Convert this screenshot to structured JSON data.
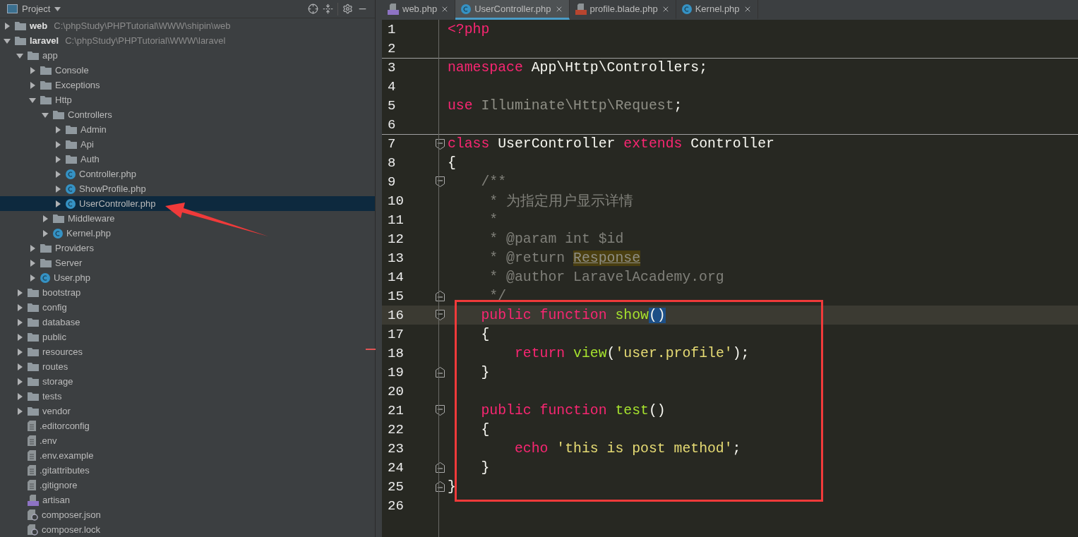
{
  "project_panel": {
    "title": "Project",
    "tree": [
      {
        "label": "web",
        "path": "C:\\phpStudy\\PHPTutorial\\WWW\\shipin\\web",
        "kind": "folder",
        "expanded": false,
        "selected": false
      },
      {
        "label": "laravel",
        "path": "C:\\phpStudy\\PHPTutorial\\WWW\\laravel",
        "kind": "folder",
        "expanded": true,
        "selected": false,
        "children": [
          {
            "label": "app",
            "kind": "folder",
            "expanded": true,
            "selected": false,
            "children": [
              {
                "label": "Console",
                "kind": "folder",
                "expanded": false,
                "selected": false
              },
              {
                "label": "Exceptions",
                "kind": "folder",
                "expanded": false,
                "selected": false
              },
              {
                "label": "Http",
                "kind": "folder",
                "expanded": true,
                "selected": false,
                "children": [
                  {
                    "label": "Controllers",
                    "kind": "folder",
                    "expanded": true,
                    "selected": false,
                    "children": [
                      {
                        "label": "Admin",
                        "kind": "folder",
                        "expanded": false,
                        "selected": false
                      },
                      {
                        "label": "Api",
                        "kind": "folder",
                        "expanded": false,
                        "selected": false
                      },
                      {
                        "label": "Auth",
                        "kind": "folder",
                        "expanded": false,
                        "selected": false
                      },
                      {
                        "label": "Controller.php",
                        "kind": "class",
                        "expanded": false,
                        "selected": false
                      },
                      {
                        "label": "ShowProfile.php",
                        "kind": "class",
                        "expanded": false,
                        "selected": false
                      },
                      {
                        "label": "UserController.php",
                        "kind": "class",
                        "expanded": false,
                        "selected": true
                      }
                    ]
                  },
                  {
                    "label": "Middleware",
                    "kind": "folder",
                    "expanded": false,
                    "selected": false
                  },
                  {
                    "label": "Kernel.php",
                    "kind": "class",
                    "expanded": false,
                    "selected": false
                  }
                ]
              },
              {
                "label": "Providers",
                "kind": "folder",
                "expanded": false,
                "selected": false
              },
              {
                "label": "Server",
                "kind": "folder",
                "expanded": false,
                "selected": false
              },
              {
                "label": "User.php",
                "kind": "class",
                "expanded": false,
                "selected": false
              }
            ]
          },
          {
            "label": "bootstrap",
            "kind": "folder",
            "expanded": false,
            "selected": false
          },
          {
            "label": "config",
            "kind": "folder",
            "expanded": false,
            "selected": false
          },
          {
            "label": "database",
            "kind": "folder",
            "expanded": false,
            "selected": false
          },
          {
            "label": "public",
            "kind": "folder",
            "expanded": false,
            "selected": false
          },
          {
            "label": "resources",
            "kind": "folder",
            "expanded": false,
            "selected": false
          },
          {
            "label": "routes",
            "kind": "folder",
            "expanded": false,
            "selected": false
          },
          {
            "label": "storage",
            "kind": "folder",
            "expanded": false,
            "selected": false
          },
          {
            "label": "tests",
            "kind": "folder",
            "expanded": false,
            "selected": false
          },
          {
            "label": "vendor",
            "kind": "folder",
            "expanded": false,
            "selected": false
          },
          {
            "label": ".editorconfig",
            "kind": "text",
            "selected": false
          },
          {
            "label": ".env",
            "kind": "text",
            "selected": false
          },
          {
            "label": ".env.example",
            "kind": "text",
            "selected": false
          },
          {
            "label": ".gitattributes",
            "kind": "text",
            "selected": false
          },
          {
            "label": ".gitignore",
            "kind": "text",
            "selected": false
          },
          {
            "label": "artisan",
            "kind": "php",
            "selected": false
          },
          {
            "label": "composer.json",
            "kind": "config",
            "selected": false
          },
          {
            "label": "composer.lock",
            "kind": "config",
            "selected": false
          }
        ]
      }
    ]
  },
  "editor": {
    "tabs": [
      {
        "label": "web.php",
        "kind": "php",
        "selected": false
      },
      {
        "label": "UserController.php",
        "kind": "class",
        "selected": true
      },
      {
        "label": "profile.blade.php",
        "kind": "blade",
        "selected": false
      },
      {
        "label": "Kernel.php",
        "kind": "class",
        "selected": false
      }
    ],
    "lines": [
      {
        "number": "1",
        "current": false,
        "separator_above": false,
        "tokens": [
          {
            "text": "<?php",
            "kind": "keyword"
          }
        ]
      },
      {
        "number": "2",
        "current": false,
        "separator_above": false
      },
      {
        "number": "3",
        "current": false,
        "separator_above": true,
        "tokens": [
          {
            "text": "namespace",
            "kind": "keyword"
          },
          {
            "text": " App\\Http\\Controllers;",
            "kind": "plain"
          }
        ]
      },
      {
        "number": "4",
        "current": false,
        "separator_above": false
      },
      {
        "number": "5",
        "current": false,
        "separator_above": false,
        "tokens": [
          {
            "text": "use",
            "kind": "keyword"
          },
          {
            "text": " Illuminate\\Http\\Request",
            "kind": "unused"
          },
          {
            "text": ";",
            "kind": "plain"
          }
        ]
      },
      {
        "number": "6",
        "current": false,
        "separator_above": false
      },
      {
        "number": "7",
        "current": false,
        "separator_above": true,
        "fold": {
          "kind": "open"
        },
        "tokens": [
          {
            "text": "class",
            "kind": "keyword"
          },
          {
            "text": " UserController ",
            "kind": "plain"
          },
          {
            "text": "extends",
            "kind": "keyword"
          },
          {
            "text": " Controller",
            "kind": "plain"
          }
        ]
      },
      {
        "number": "8",
        "current": false,
        "separator_above": false,
        "tokens": [
          {
            "text": "{",
            "kind": "plain"
          }
        ]
      },
      {
        "number": "9",
        "current": false,
        "separator_above": false,
        "fold": {
          "kind": "open"
        },
        "tokens": [
          {
            "text": "    /**",
            "kind": "comment"
          }
        ]
      },
      {
        "number": "10",
        "current": false,
        "separator_above": false,
        "tokens": [
          {
            "text": "     * 为指定用户显示详情",
            "kind": "comment"
          }
        ]
      },
      {
        "number": "11",
        "current": false,
        "separator_above": false,
        "tokens": [
          {
            "text": "     *",
            "kind": "comment"
          }
        ]
      },
      {
        "number": "12",
        "current": false,
        "separator_above": false,
        "tokens": [
          {
            "text": "     * @param int $id",
            "kind": "comment"
          }
        ]
      },
      {
        "number": "13",
        "current": false,
        "separator_above": false,
        "tokens": [
          {
            "text": "     * @return ",
            "kind": "comment"
          },
          {
            "text": "Response",
            "kind": "marked"
          }
        ]
      },
      {
        "number": "14",
        "current": false,
        "separator_above": false,
        "tokens": [
          {
            "text": "     * @author LaravelAcademy.org",
            "kind": "comment"
          }
        ]
      },
      {
        "number": "15",
        "current": false,
        "separator_above": false,
        "fold": {
          "kind": "close"
        },
        "tokens": [
          {
            "text": "     */",
            "kind": "comment"
          }
        ]
      },
      {
        "number": "16",
        "current": true,
        "separator_above": false,
        "fold": {
          "kind": "open"
        },
        "tokens": [
          {
            "text": "    public function",
            "kind": "keyword"
          },
          {
            "text": " show",
            "kind": "function"
          },
          {
            "text": "()",
            "kind": "matched"
          }
        ]
      },
      {
        "number": "17",
        "current": false,
        "separator_above": false,
        "tokens": [
          {
            "text": "    {",
            "kind": "plain"
          }
        ]
      },
      {
        "number": "18",
        "current": false,
        "separator_above": false,
        "tokens": [
          {
            "text": "        return",
            "kind": "keyword"
          },
          {
            "text": " view",
            "kind": "function"
          },
          {
            "text": "(",
            "kind": "plain"
          },
          {
            "text": "'user.profile'",
            "kind": "string"
          },
          {
            "text": ");",
            "kind": "plain"
          }
        ]
      },
      {
        "number": "19",
        "current": false,
        "separator_above": false,
        "fold": {
          "kind": "close"
        },
        "tokens": [
          {
            "text": "    }",
            "kind": "plain"
          }
        ]
      },
      {
        "number": "20",
        "current": false,
        "separator_above": false
      },
      {
        "number": "21",
        "current": false,
        "separator_above": false,
        "fold": {
          "kind": "open"
        },
        "tokens": [
          {
            "text": "    public function",
            "kind": "keyword"
          },
          {
            "text": " test",
            "kind": "function"
          },
          {
            "text": "()",
            "kind": "plain"
          }
        ]
      },
      {
        "number": "22",
        "current": false,
        "separator_above": false,
        "tokens": [
          {
            "text": "    {",
            "kind": "plain"
          }
        ]
      },
      {
        "number": "23",
        "current": false,
        "separator_above": false,
        "tokens": [
          {
            "text": "        echo",
            "kind": "keyword"
          },
          {
            "text": " 'this is post method'",
            "kind": "string"
          },
          {
            "text": ";",
            "kind": "plain"
          }
        ]
      },
      {
        "number": "24",
        "current": false,
        "separator_above": false,
        "fold": {
          "kind": "close"
        },
        "tokens": [
          {
            "text": "    }",
            "kind": "plain"
          }
        ]
      },
      {
        "number": "25",
        "current": false,
        "separator_above": false,
        "fold": {
          "kind": "close"
        },
        "tokens": [
          {
            "text": "}",
            "kind": "plain"
          }
        ]
      },
      {
        "number": "26",
        "current": false,
        "separator_above": false
      }
    ]
  }
}
